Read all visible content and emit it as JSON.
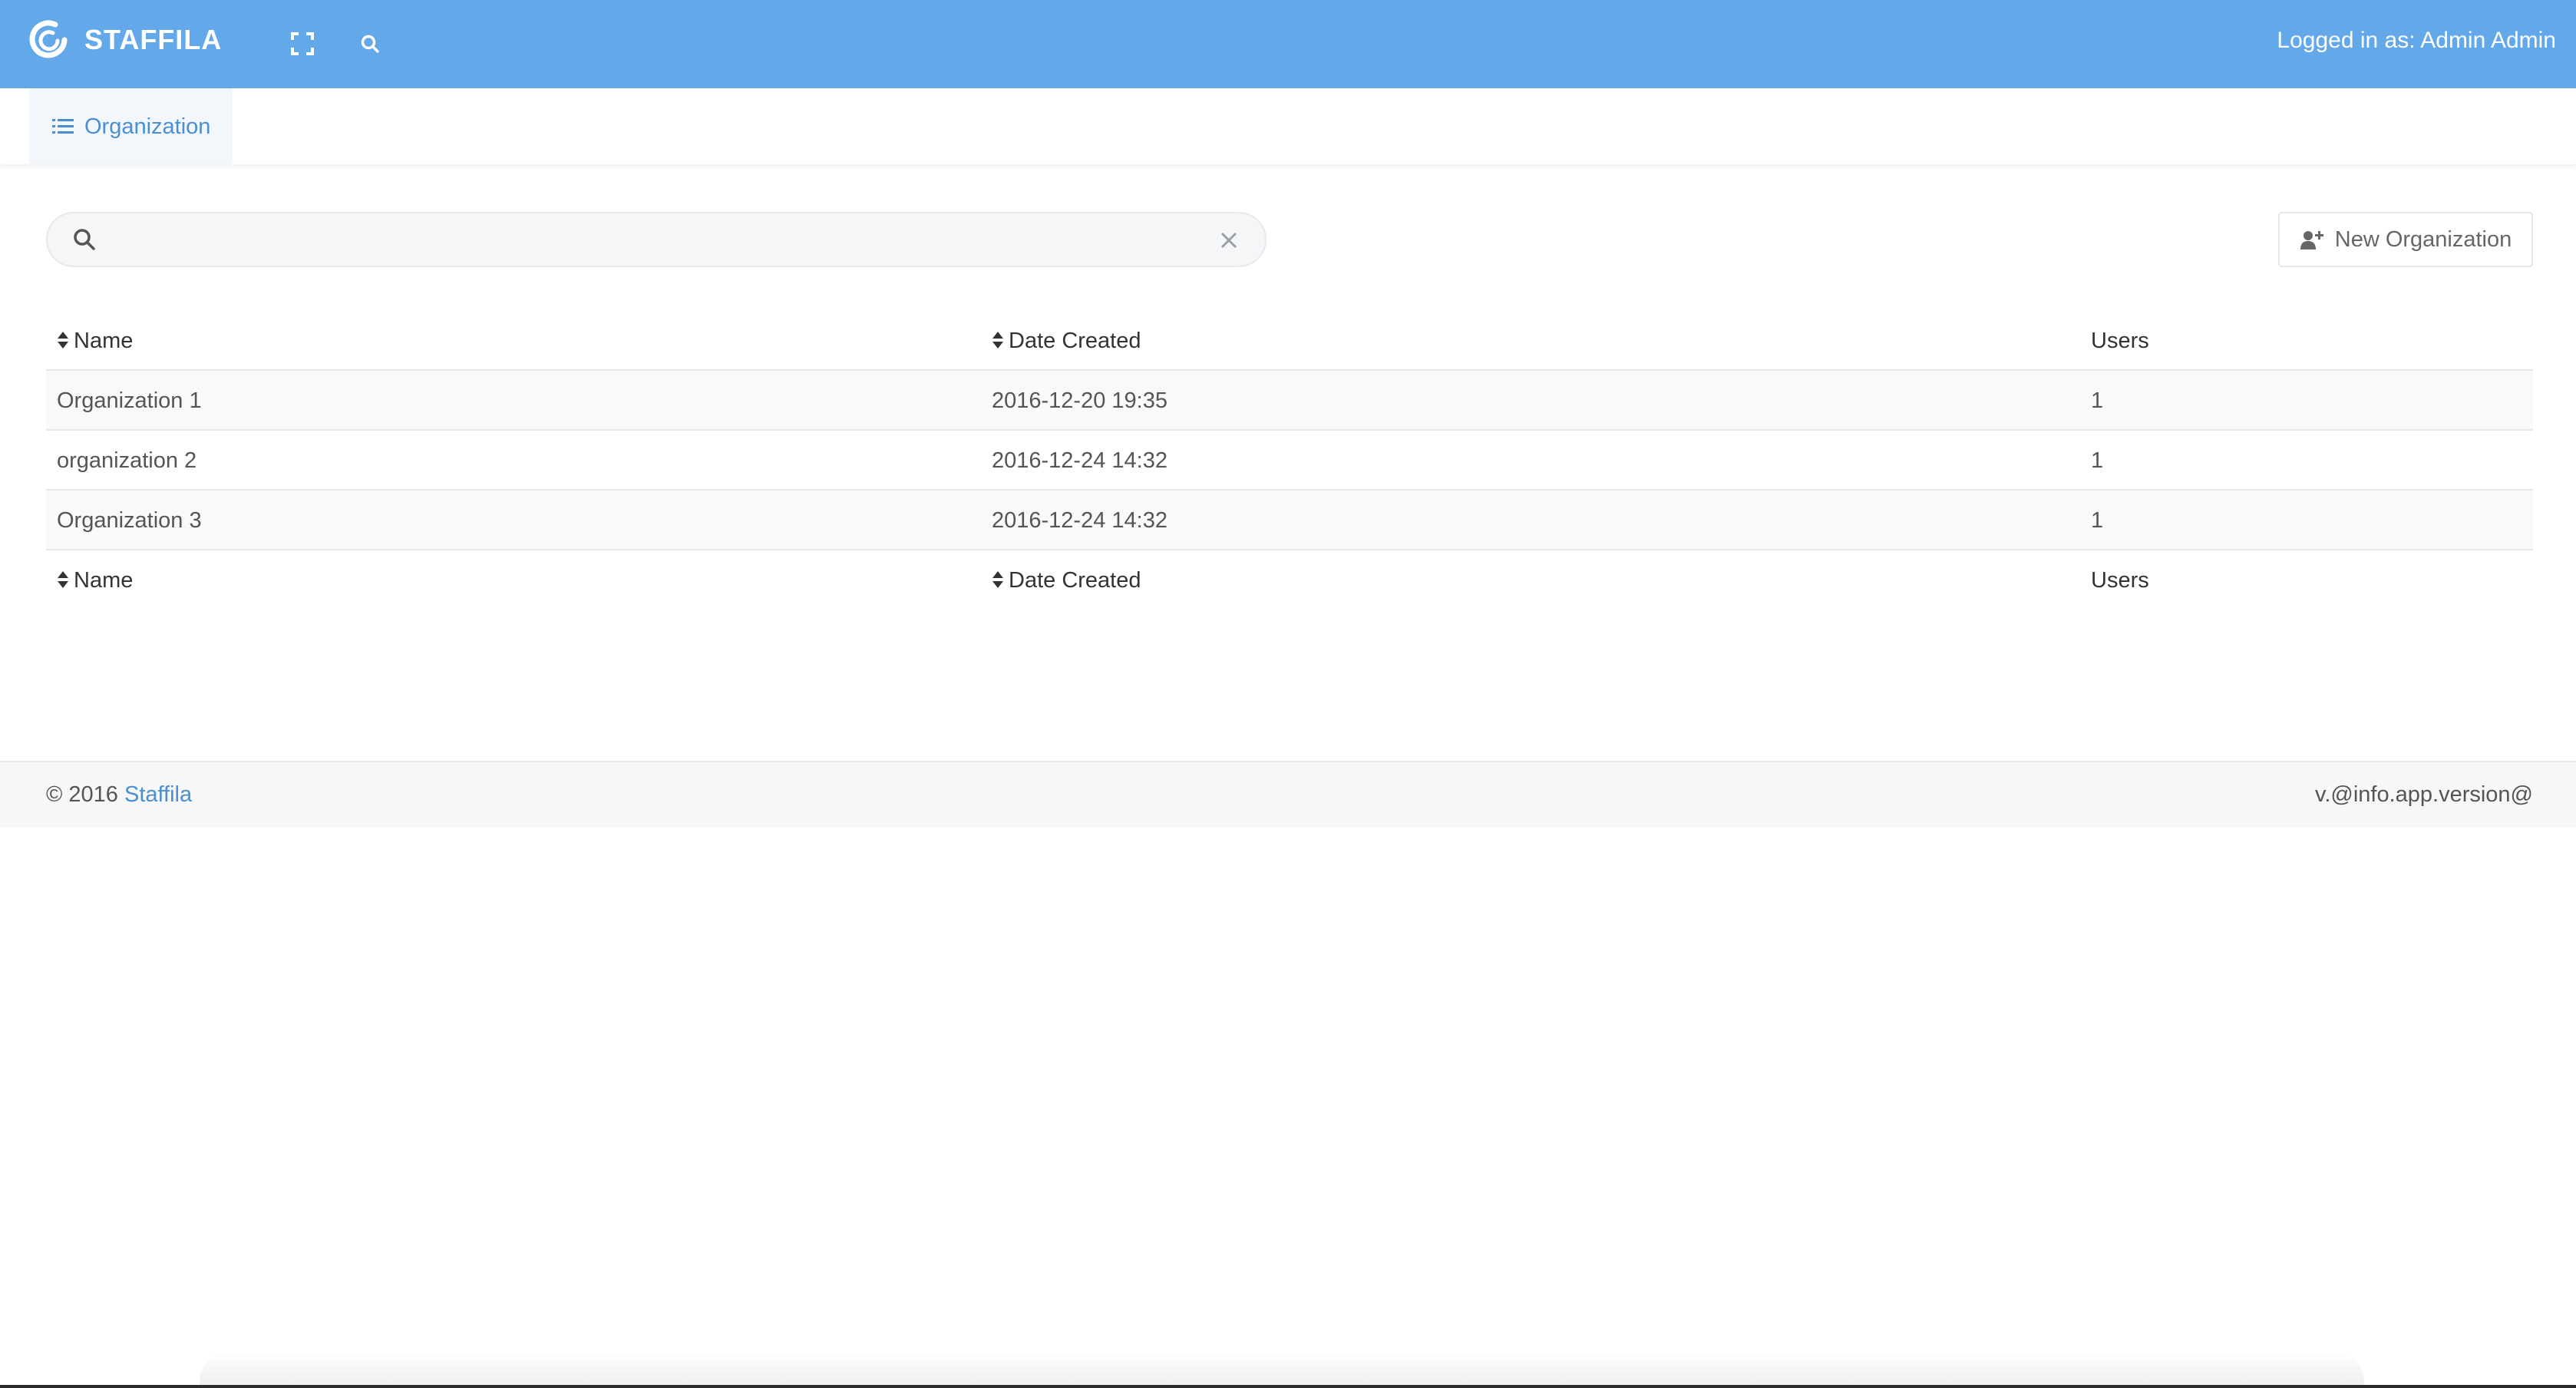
{
  "app": {
    "name": "STAFFILA",
    "logged_in_text": "Logged in as: Admin Admin"
  },
  "icons": {
    "logo": "staffila-logo-icon",
    "fullscreen": "fullscreen-icon",
    "search": "search-icon",
    "list": "list-icon",
    "clear": "close-icon",
    "add_user": "add-user-icon",
    "sort": "sort-icon"
  },
  "tabs": [
    {
      "label": "Organization"
    }
  ],
  "search": {
    "value": "",
    "placeholder": ""
  },
  "toolbar": {
    "new_org_label": "New Organization"
  },
  "table": {
    "columns": [
      "Name",
      "Date Created",
      "Users"
    ],
    "rows": [
      {
        "name": "Organization 1",
        "date": "2016-12-20 19:35",
        "users": "1"
      },
      {
        "name": "organization 2",
        "date": "2016-12-24 14:32",
        "users": "1"
      },
      {
        "name": "Organization 3",
        "date": "2016-12-24 14:32",
        "users": "1"
      }
    ]
  },
  "footer": {
    "copyright_prefix": "© 2016 ",
    "link_text": "Staffila",
    "version": "v.@info.app.version@"
  },
  "colors": {
    "topbar": "#63a8e8",
    "accent": "#4a90d0"
  }
}
